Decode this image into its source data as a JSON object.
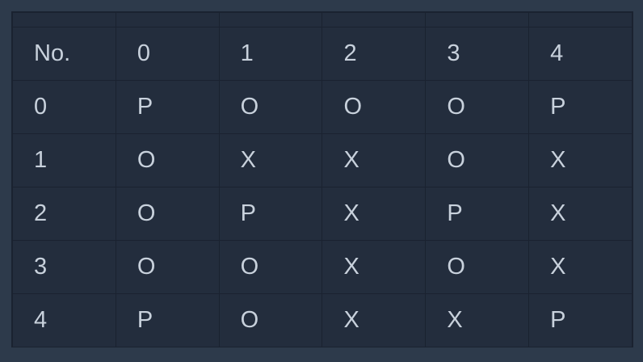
{
  "grid": {
    "header": [
      "No.",
      "0",
      "1",
      "2",
      "3",
      "4"
    ],
    "rows": [
      [
        "0",
        "P",
        "O",
        "O",
        "O",
        "P"
      ],
      [
        "1",
        "O",
        "X",
        "X",
        "O",
        "X"
      ],
      [
        "2",
        "O",
        "P",
        "X",
        "P",
        "X"
      ],
      [
        "3",
        "O",
        "O",
        "X",
        "O",
        "X"
      ],
      [
        "4",
        "P",
        "O",
        "X",
        "X",
        "P"
      ]
    ]
  },
  "colors": {
    "page_background": "#2d3a4b",
    "cell_background": "#232d3d",
    "grid_line": "#1a2230",
    "text": "#c8d1dc"
  }
}
